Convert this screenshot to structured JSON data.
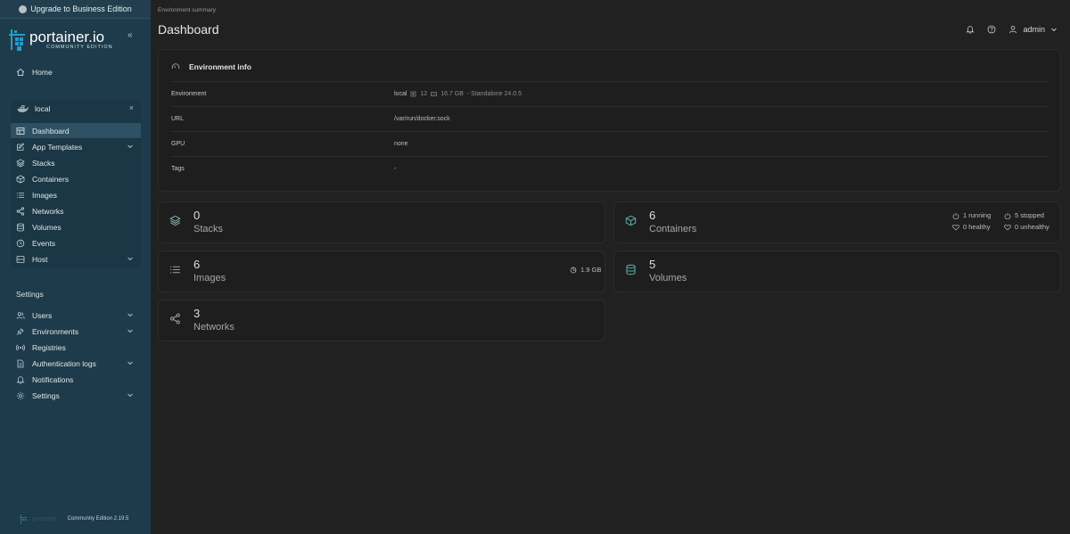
{
  "upgrade": {
    "label": "Upgrade to Business Edition"
  },
  "brand": {
    "name": "portainer.io",
    "edition": "COMMUNITY EDITION"
  },
  "sidebar": {
    "collapse_label": "«",
    "home": "Home",
    "environment": {
      "name": "local",
      "close": "×"
    },
    "env_items": [
      {
        "label": "Dashboard",
        "icon": "dashboard-icon",
        "active": true
      },
      {
        "label": "App Templates",
        "icon": "edit-icon",
        "chevron": true
      },
      {
        "label": "Stacks",
        "icon": "layers-icon"
      },
      {
        "label": "Containers",
        "icon": "box-icon"
      },
      {
        "label": "Images",
        "icon": "list-icon"
      },
      {
        "label": "Networks",
        "icon": "share-icon"
      },
      {
        "label": "Volumes",
        "icon": "database-icon"
      },
      {
        "label": "Events",
        "icon": "clock-icon"
      },
      {
        "label": "Host",
        "icon": "server-icon",
        "chevron": true
      }
    ],
    "settings_heading": "Settings",
    "settings_items": [
      {
        "label": "Users",
        "icon": "users-icon",
        "chevron": true
      },
      {
        "label": "Environments",
        "icon": "plug-icon",
        "chevron": true
      },
      {
        "label": "Registries",
        "icon": "radio-icon"
      },
      {
        "label": "Authentication logs",
        "icon": "file-text-icon",
        "chevron": true
      },
      {
        "label": "Notifications",
        "icon": "bell-icon"
      },
      {
        "label": "Settings",
        "icon": "gear-icon",
        "chevron": true
      }
    ],
    "footer": {
      "logo_text": "portainer",
      "version": "Community Edition 2.19.5"
    }
  },
  "header": {
    "breadcrumb": "Environment summary",
    "title": "Dashboard",
    "user": "admin"
  },
  "env_info": {
    "title": "Environment info",
    "rows": [
      {
        "key": "Environment",
        "value_name": "local",
        "cpu": "12",
        "memory": "16.7 GB",
        "details": "- Standalone 24.0.5"
      },
      {
        "key": "URL",
        "value": "/var/run/docker.sock"
      },
      {
        "key": "GPU",
        "value": "none"
      },
      {
        "key": "Tags",
        "value": "-"
      }
    ]
  },
  "stats": {
    "stacks": {
      "value": "0",
      "label": "Stacks"
    },
    "containers": {
      "value": "6",
      "label": "Containers",
      "running": "1 running",
      "stopped": "5 stopped",
      "healthy": "0 healthy",
      "unhealthy": "0 unhealthy"
    },
    "images": {
      "value": "6",
      "label": "Images",
      "size": "1.9 GB"
    },
    "volumes": {
      "value": "5",
      "label": "Volumes"
    },
    "networks": {
      "value": "3",
      "label": "Networks"
    }
  },
  "colors": {
    "sidebar_bg": "#1e3b4b",
    "sidebar_active": "#2d5163",
    "main_bg": "#212121",
    "card_bg": "#1e1e1e",
    "accent": "#2a9ac9"
  }
}
